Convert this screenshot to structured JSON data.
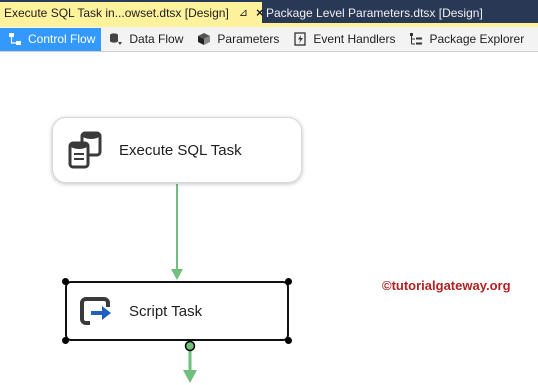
{
  "document_tabs": [
    {
      "label": "Execute SQL Task in...owset.dtsx [Design]",
      "pin": "⊿",
      "close": "×"
    },
    {
      "label": "Package Level Parameters.dtsx [Design]"
    }
  ],
  "designer_tabs": [
    {
      "label": "Control Flow",
      "icon": "control-flow-icon"
    },
    {
      "label": "Data Flow",
      "icon": "data-flow-icon"
    },
    {
      "label": "Parameters",
      "icon": "parameters-icon"
    },
    {
      "label": "Event Handlers",
      "icon": "event-handlers-icon"
    },
    {
      "label": "Package Explorer",
      "icon": "package-explorer-icon"
    }
  ],
  "canvas": {
    "tasks": [
      {
        "label": "Execute SQL Task",
        "icon": "execute-sql-icon"
      },
      {
        "label": "Script Task",
        "icon": "script-task-icon"
      }
    ],
    "watermark": "©tutorialgateway.org"
  },
  "colors": {
    "tab_bar": "#293955",
    "active_tab": "#fff29d",
    "selected_designer_tab": "#3399ff",
    "precedence_constraint": "#6fbf7d"
  }
}
